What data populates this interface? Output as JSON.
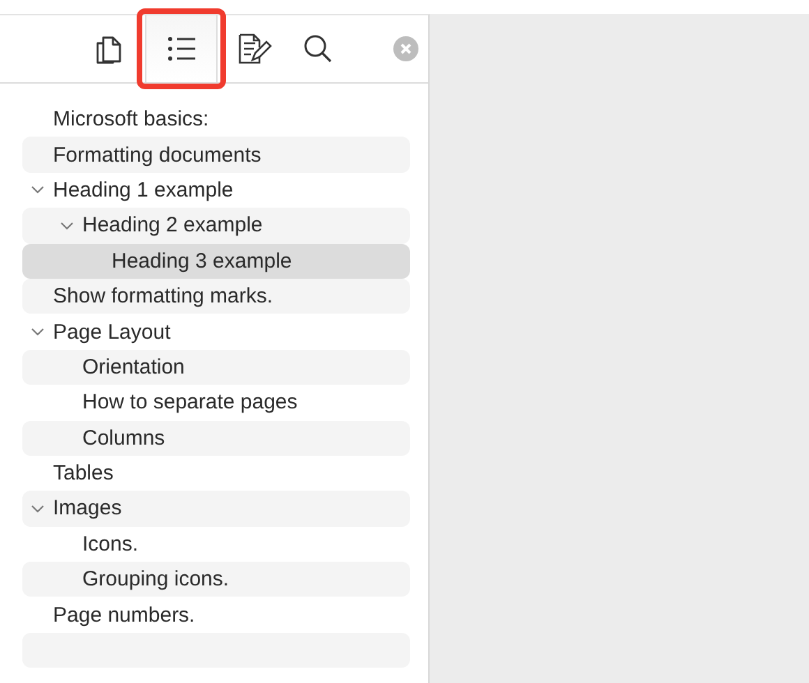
{
  "tabs": [
    {
      "kind": "pages",
      "selected": false
    },
    {
      "kind": "outline",
      "selected": true
    },
    {
      "kind": "notes",
      "selected": false
    },
    {
      "kind": "search",
      "selected": false
    }
  ],
  "outline": [
    {
      "label": "Microsoft basics:",
      "selected": false
    },
    {
      "label": "Formatting documents",
      "selected": false
    },
    {
      "label": "Heading 1 example",
      "selected": false,
      "expanded": true,
      "children": [
        {
          "label": "Heading 2 example",
          "selected": false,
          "expanded": true,
          "children": [
            {
              "label": "Heading 3 example",
              "selected": true
            }
          ]
        }
      ]
    },
    {
      "label": "Show formatting marks.",
      "selected": false
    },
    {
      "label": "Page Layout",
      "selected": false,
      "expanded": true,
      "children": [
        {
          "label": "Orientation",
          "selected": false
        },
        {
          "label": "How to separate pages",
          "selected": false
        },
        {
          "label": "Columns",
          "selected": false
        }
      ]
    },
    {
      "label": "Tables",
      "selected": false
    },
    {
      "label": "Images",
      "selected": false,
      "expanded": true,
      "children": [
        {
          "label": "Icons.",
          "selected": false
        },
        {
          "label": "Grouping icons.",
          "selected": false
        }
      ]
    },
    {
      "label": "Page numbers.",
      "selected": false
    }
  ]
}
